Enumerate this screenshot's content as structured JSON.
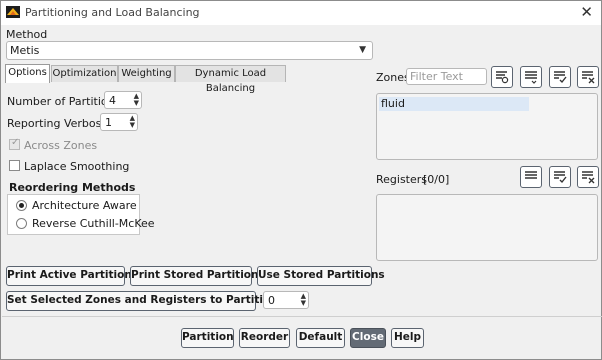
{
  "window": {
    "title": "Partitioning and Load Balancing",
    "close_glyph": "✕",
    "app_icon": "fluent-logo-icon"
  },
  "method": {
    "label": "Method",
    "value": "Metis"
  },
  "tabs": [
    {
      "label": "Options",
      "active": true
    },
    {
      "label": "Optimization",
      "active": false
    },
    {
      "label": "Weighting",
      "active": false
    },
    {
      "label": "Dynamic Load Balancing",
      "active": false
    }
  ],
  "options": {
    "num_partitions_label": "Number of Partitions",
    "num_partitions_value": "4",
    "reporting_verbosity_label": "Reporting Verbosity",
    "reporting_verbosity_value": "1",
    "across_zones_label": "Across Zones",
    "across_zones_checked": true,
    "laplace_label": "Laplace Smoothing",
    "laplace_checked": false,
    "reordering_label": "Reordering Methods",
    "reordering_options": [
      {
        "label": "Architecture Aware",
        "selected": true
      },
      {
        "label": "Reverse Cuthill-McKee",
        "selected": false
      }
    ]
  },
  "zones": {
    "label": "Zones",
    "filter_placeholder": "Filter Text",
    "items": [
      "fluid"
    ],
    "icons": [
      "filter-zones-icon",
      "select-all-icon",
      "check-all-icon",
      "deselect-all-icon"
    ]
  },
  "registers": {
    "label": "Registers",
    "count": "[0/0]",
    "icons": [
      "select-all-icon",
      "check-all-icon",
      "deselect-all-icon"
    ]
  },
  "action_buttons": {
    "print_active": "Print Active Partitions",
    "print_stored": "Print Stored Partitions",
    "use_stored": "Use Stored Partitions",
    "set_selected": "Set Selected Zones and Registers to Partition ID",
    "partition_id_value": "0"
  },
  "footer": {
    "partition": "Partition",
    "reorder": "Reorder",
    "default": "Default",
    "close": "Close",
    "help": "Help"
  },
  "colors": {
    "primary_button": "#636b75",
    "selected_item": "#dce8f6"
  }
}
